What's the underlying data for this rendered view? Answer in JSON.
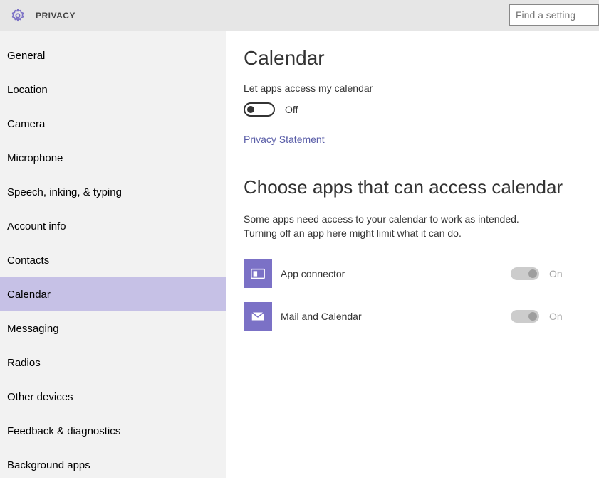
{
  "header": {
    "title": "PRIVACY",
    "search_placeholder": "Find a setting"
  },
  "sidebar": {
    "items": [
      {
        "label": "General",
        "selected": false
      },
      {
        "label": "Location",
        "selected": false
      },
      {
        "label": "Camera",
        "selected": false
      },
      {
        "label": "Microphone",
        "selected": false
      },
      {
        "label": "Speech, inking, & typing",
        "selected": false
      },
      {
        "label": "Account info",
        "selected": false
      },
      {
        "label": "Contacts",
        "selected": false
      },
      {
        "label": "Calendar",
        "selected": true
      },
      {
        "label": "Messaging",
        "selected": false
      },
      {
        "label": "Radios",
        "selected": false
      },
      {
        "label": "Other devices",
        "selected": false
      },
      {
        "label": "Feedback & diagnostics",
        "selected": false
      },
      {
        "label": "Background apps",
        "selected": false
      }
    ]
  },
  "main": {
    "title": "Calendar",
    "master_toggle": {
      "label": "Let apps access my calendar",
      "state": "Off"
    },
    "privacy_link": "Privacy Statement",
    "apps_section": {
      "heading": "Choose apps that can access calendar",
      "description": "Some apps need access to your calendar to work as intended. Turning off an app here might limit what it can do.",
      "apps": [
        {
          "icon": "app-connector-icon",
          "label": "App connector",
          "state": "On"
        },
        {
          "icon": "mail-icon",
          "label": "Mail and Calendar",
          "state": "On"
        }
      ]
    }
  }
}
